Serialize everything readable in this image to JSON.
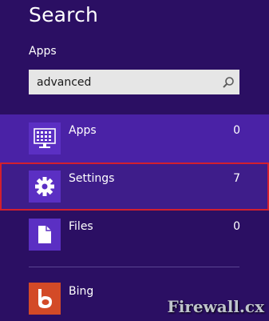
{
  "page": {
    "title": "Search",
    "scope": "Apps"
  },
  "search": {
    "value": "advanced",
    "icon": "search-icon"
  },
  "results": [
    {
      "label": "Apps",
      "count": "0",
      "icon": "apps-grid-monitor-icon"
    },
    {
      "label": "Settings",
      "count": "7",
      "icon": "gear-icon"
    },
    {
      "label": "Files",
      "count": "0",
      "icon": "file-icon"
    }
  ],
  "bing": {
    "label": "Bing",
    "icon": "bing-logo-icon"
  },
  "watermark": "Firewall.cx",
  "colors": {
    "background": "#2b0f63",
    "apps_highlight": "#4a22a6",
    "settings_highlight": "#3e1d8a",
    "selection_border": "#d21f2e",
    "tile": "#5b2fc3",
    "bing_tile": "#d34a27"
  }
}
